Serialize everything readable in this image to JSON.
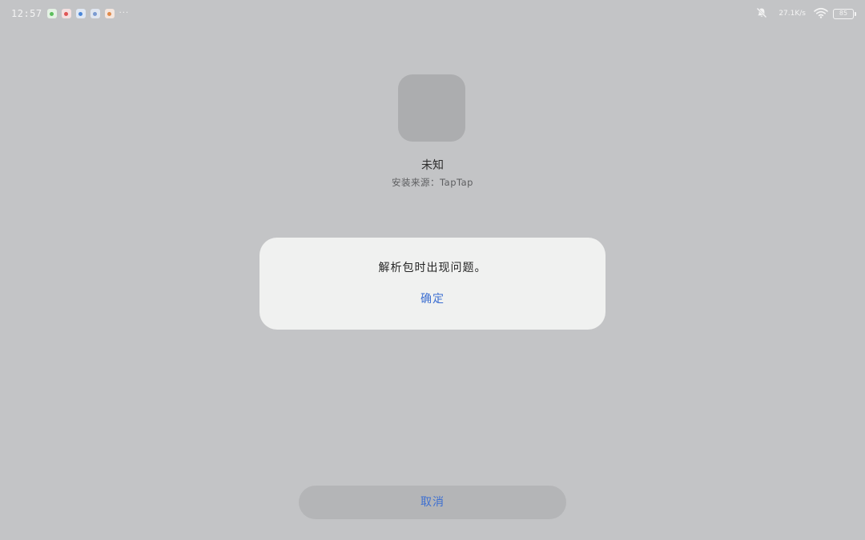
{
  "status_bar": {
    "time": "12:57",
    "network_speed": "27.1K/s",
    "battery_level": "85",
    "notification_icons": [
      {
        "name": "wechat-icon",
        "bg": "#e4f2e4",
        "dot": "#5cbf5c"
      },
      {
        "name": "red-app-icon",
        "bg": "#f4e0e0",
        "dot": "#e05555"
      },
      {
        "name": "compass-icon",
        "bg": "#e0e8f4",
        "dot": "#4a86d8"
      },
      {
        "name": "blue-app-icon",
        "bg": "#e0e6f0",
        "dot": "#7a9ad0"
      },
      {
        "name": "map-pin-icon",
        "bg": "#f4e6de",
        "dot": "#e08a4a"
      }
    ],
    "more_indicator": "···"
  },
  "app": {
    "name": "未知",
    "install_source": "安装来源：TapTap"
  },
  "dialog": {
    "message": "解析包时出现问题。",
    "confirm_label": "确定"
  },
  "footer": {
    "cancel_label": "取消"
  },
  "colors": {
    "background": "#c3c4c6",
    "dialog_bg": "#f0f1f0",
    "accent": "#3d6fd1"
  }
}
